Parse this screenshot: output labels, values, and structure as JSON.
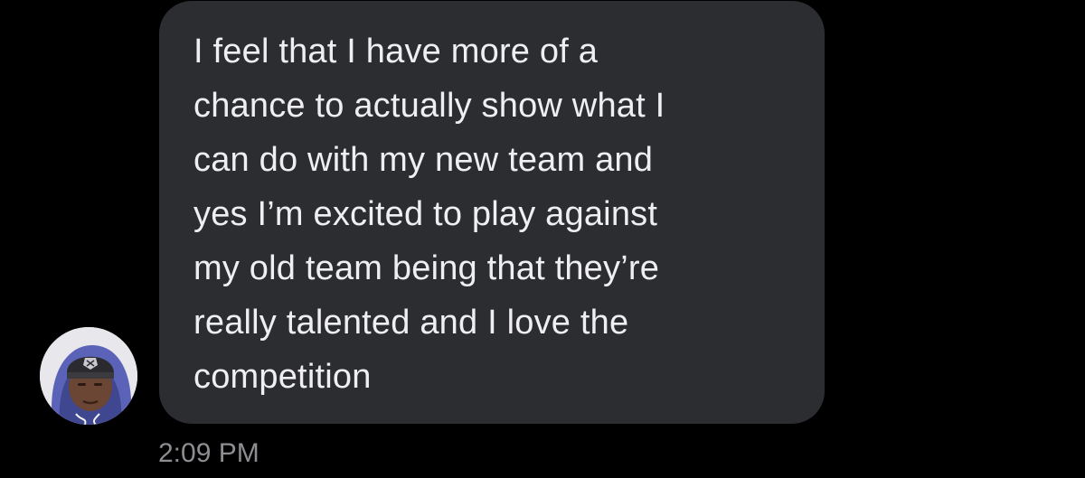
{
  "conversation": {
    "message": {
      "text": "I feel that I have more of a\nchance to actually show what I\ncan do with my new team and\nyes I’m excited to play against\nmy old team being that they’re\nreally talented and I love the\ncompetition",
      "timestamp": "2:09 PM"
    },
    "sender": {
      "avatar_icon": "contact-photo-icon"
    }
  },
  "colors": {
    "background": "#000000",
    "bubble": "#2c2d31",
    "message_text": "#efeff1",
    "timestamp_text": "#8d8d92"
  }
}
